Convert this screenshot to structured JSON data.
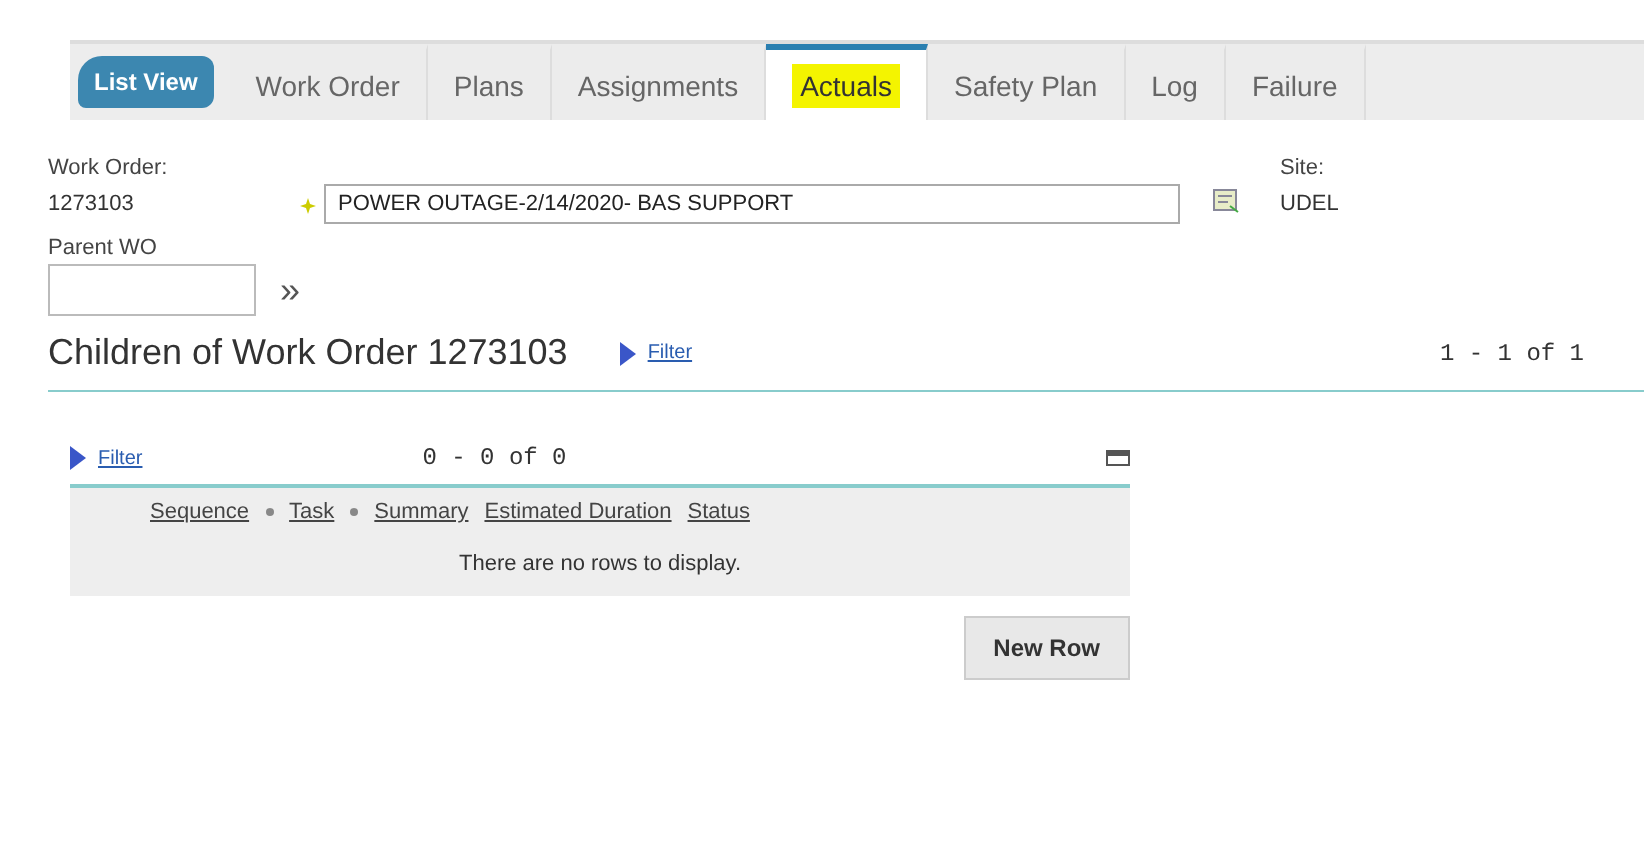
{
  "tab_bar": {
    "list_view_button": "List View",
    "tabs": [
      {
        "label": "Work Order",
        "selected": false
      },
      {
        "label": "Plans",
        "selected": false
      },
      {
        "label": "Assignments",
        "selected": false
      },
      {
        "label": "Actuals",
        "selected": true
      },
      {
        "label": "Safety Plan",
        "selected": false
      },
      {
        "label": "Log",
        "selected": false
      },
      {
        "label": "Failure",
        "selected": false
      }
    ]
  },
  "work_order": {
    "label": "Work Order:",
    "value": "1273103",
    "required": true,
    "description": "POWER OUTAGE-2/14/2020- BAS SUPPORT"
  },
  "site": {
    "label": "Site:",
    "value": "UDEL"
  },
  "parent_wo": {
    "label": "Parent WO",
    "more_button": "»"
  },
  "children_section": {
    "title": "Children of Work Order 1273103",
    "filter_link": "Filter",
    "pagination": "1 - 1 of 1"
  },
  "children_table": {
    "filter_link": "Filter",
    "pagination": "0 - 0 of 0",
    "columns": [
      {
        "label": "Sequence",
        "sort_marker": true
      },
      {
        "label": "Task",
        "sort_marker": true
      },
      {
        "label": "Summary",
        "sort_marker": false
      },
      {
        "label": "Estimated Duration",
        "sort_marker": false
      },
      {
        "label": "Status",
        "sort_marker": false
      }
    ],
    "empty_message": "There are no rows to display.",
    "new_row_button": "New Row"
  }
}
